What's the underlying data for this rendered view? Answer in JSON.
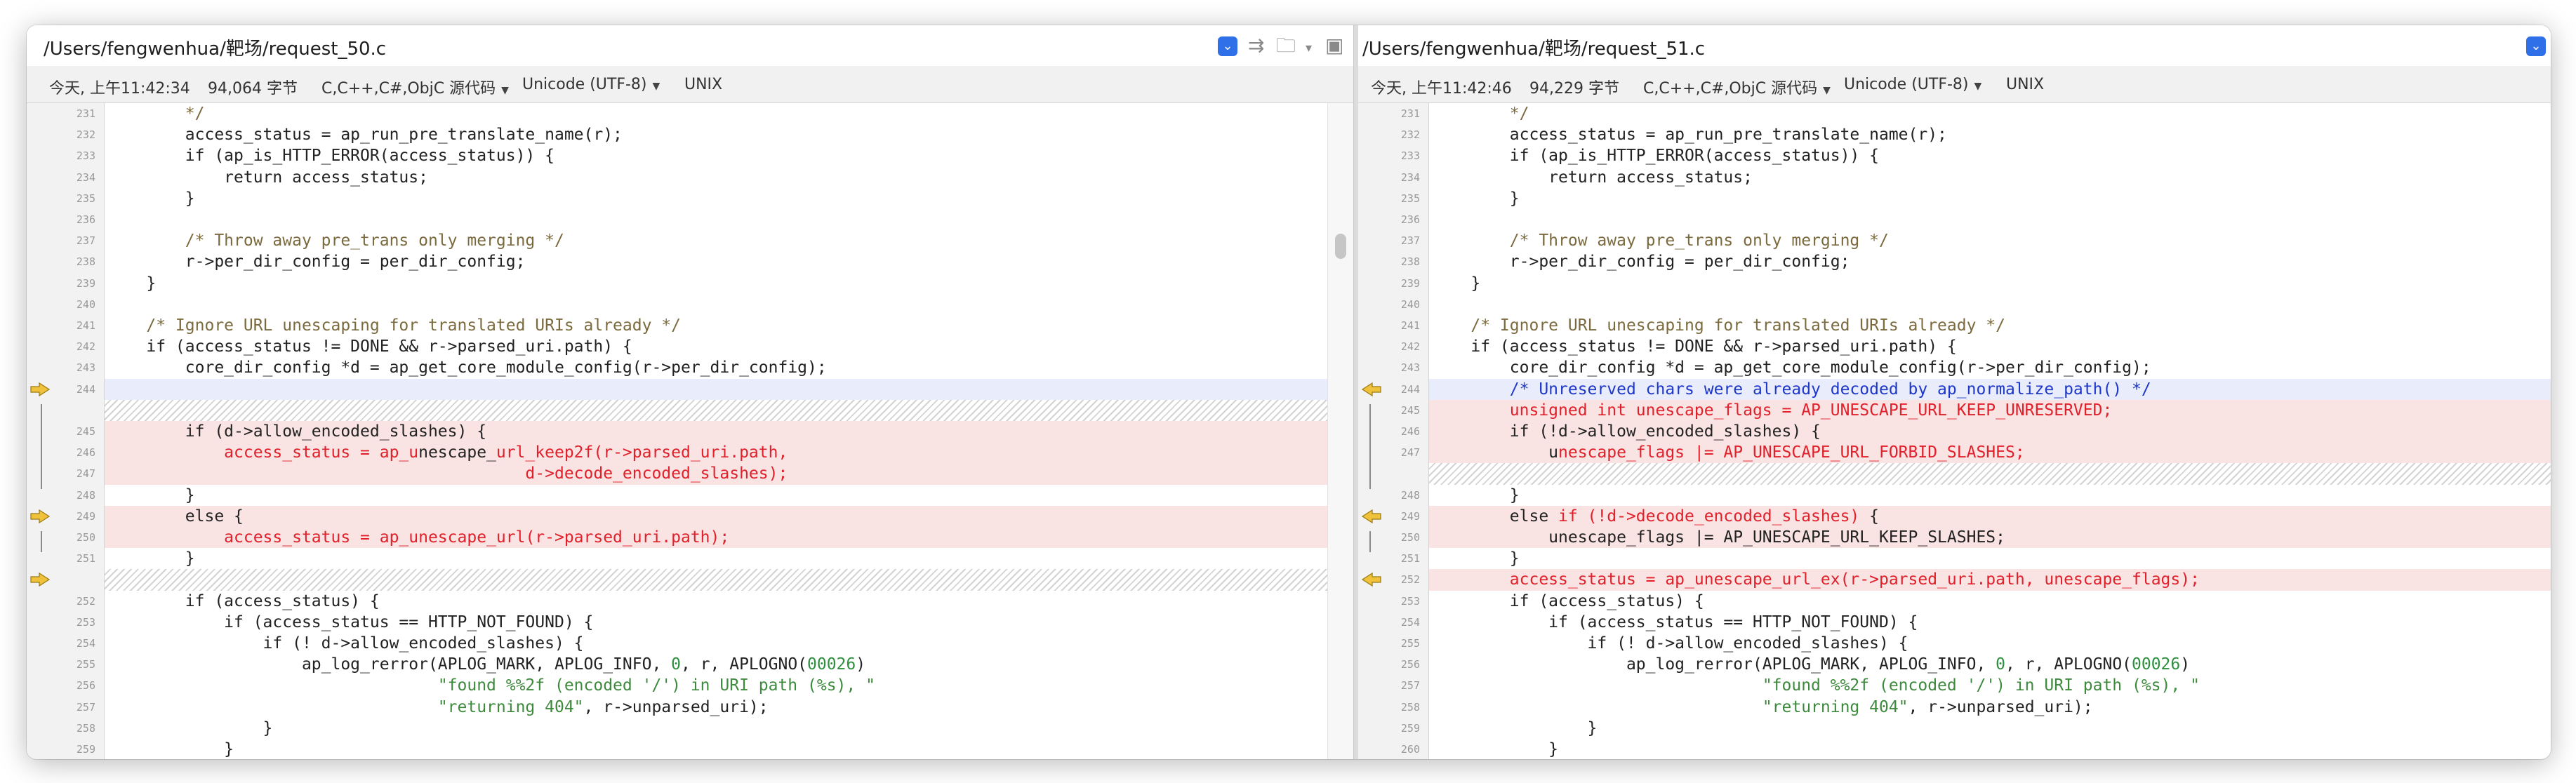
{
  "left": {
    "path": "/Users/fengwenhua/靶场/request_50.c",
    "info": {
      "time": "今天, 上午11:42:34",
      "size": "94,064 字节",
      "lang": "C,C++,C#,ObjC 源代码",
      "encoding": "Unicode (UTF-8)",
      "eol": "UNIX"
    },
    "lines": [
      {
        "n": "231",
        "type": "",
        "segs": [
          [
            "        */",
            "comment"
          ]
        ]
      },
      {
        "n": "232",
        "type": "",
        "segs": [
          [
            "        access_status = ap_run_pre_translate_name(r);",
            ""
          ]
        ]
      },
      {
        "n": "233",
        "type": "",
        "segs": [
          [
            "        if (ap_is_HTTP_ERROR(access_status)) {",
            ""
          ]
        ]
      },
      {
        "n": "234",
        "type": "",
        "segs": [
          [
            "            return access_status;",
            ""
          ]
        ]
      },
      {
        "n": "235",
        "type": "",
        "segs": [
          [
            "        }",
            ""
          ]
        ]
      },
      {
        "n": "236",
        "type": "",
        "segs": []
      },
      {
        "n": "237",
        "type": "",
        "segs": [
          [
            "        /* Throw away pre_trans only merging */",
            "comment"
          ]
        ]
      },
      {
        "n": "238",
        "type": "",
        "segs": [
          [
            "        r->per_dir_config = per_dir_config;",
            ""
          ]
        ]
      },
      {
        "n": "239",
        "type": "",
        "segs": [
          [
            "    }",
            ""
          ]
        ]
      },
      {
        "n": "240",
        "type": "",
        "segs": []
      },
      {
        "n": "241",
        "type": "",
        "segs": [
          [
            "    /* Ignore URL unescaping for translated URIs already */",
            "comment"
          ]
        ]
      },
      {
        "n": "242",
        "type": "",
        "segs": [
          [
            "    if (access_status != DONE && r->parsed_uri.path) {",
            ""
          ]
        ]
      },
      {
        "n": "243",
        "type": "",
        "segs": [
          [
            "        core_dir_config *d = ap_get_core_module_config(r->per_dir_config);",
            ""
          ]
        ]
      },
      {
        "n": "244",
        "type": "cur",
        "segs": []
      },
      {
        "n": "",
        "type": "hatch",
        "segs": []
      },
      {
        "n": "245",
        "type": "changed",
        "segs": [
          [
            "        if (d->allow_encoded_slashes) {",
            ""
          ]
        ]
      },
      {
        "n": "246",
        "type": "changed",
        "segs": [
          [
            "            access_status = ap_u",
            "red"
          ],
          [
            "nescape_",
            ""
          ],
          [
            "url_keep2f(r->parsed_uri.path,",
            "red"
          ]
        ]
      },
      {
        "n": "247",
        "type": "changed",
        "segs": [
          [
            "                                           d->decode_encoded_slashes);",
            "red"
          ]
        ]
      },
      {
        "n": "248",
        "type": "",
        "segs": [
          [
            "        }",
            ""
          ]
        ]
      },
      {
        "n": "249",
        "type": "changed",
        "segs": [
          [
            "        else {",
            ""
          ]
        ]
      },
      {
        "n": "250",
        "type": "changed",
        "segs": [
          [
            "            access_status = ap_unescape_url",
            "red"
          ],
          [
            "(r->parsed_uri.path);",
            "red"
          ]
        ]
      },
      {
        "n": "251",
        "type": "",
        "segs": [
          [
            "        }",
            ""
          ]
        ]
      },
      {
        "n": "",
        "type": "hatch",
        "segs": []
      },
      {
        "n": "252",
        "type": "",
        "segs": [
          [
            "        if (access_status) {",
            ""
          ]
        ]
      },
      {
        "n": "253",
        "type": "",
        "segs": [
          [
            "            if (access_status == HTTP_NOT_FOUND) {",
            ""
          ]
        ]
      },
      {
        "n": "254",
        "type": "",
        "segs": [
          [
            "                if (! d->allow_encoded_slashes) {",
            ""
          ]
        ]
      },
      {
        "n": "255",
        "type": "",
        "segs": [
          [
            "                    ap_log_rerror(APLOG_MARK, APLOG_INFO, ",
            ""
          ],
          [
            "0",
            "num"
          ],
          [
            ", r, APLOGNO(",
            ""
          ],
          [
            "00026",
            "num"
          ],
          [
            ")",
            ""
          ]
        ]
      },
      {
        "n": "256",
        "type": "",
        "segs": [
          [
            "                                  ",
            ""
          ],
          [
            "\"found %%2f (encoded '/') in URI path (%s), \"",
            "str"
          ]
        ]
      },
      {
        "n": "257",
        "type": "",
        "segs": [
          [
            "                                  ",
            ""
          ],
          [
            "\"returning 404\"",
            "str"
          ],
          [
            ", r->unparsed_uri);",
            ""
          ]
        ]
      },
      {
        "n": "258",
        "type": "",
        "segs": [
          [
            "                }",
            ""
          ]
        ]
      },
      {
        "n": "259",
        "type": "",
        "segs": [
          [
            "            }",
            ""
          ]
        ]
      }
    ]
  },
  "right": {
    "path": "/Users/fengwenhua/靶场/request_51.c",
    "info": {
      "time": "今天, 上午11:42:46",
      "size": "94,229 字节",
      "lang": "C,C++,C#,ObjC 源代码",
      "encoding": "Unicode (UTF-8)",
      "eol": "UNIX"
    },
    "lines": [
      {
        "n": "231",
        "type": "",
        "segs": [
          [
            "        */",
            "comment"
          ]
        ]
      },
      {
        "n": "232",
        "type": "",
        "segs": [
          [
            "        access_status = ap_run_pre_translate_name(r);",
            ""
          ]
        ]
      },
      {
        "n": "233",
        "type": "",
        "segs": [
          [
            "        if (ap_is_HTTP_ERROR(access_status)) {",
            ""
          ]
        ]
      },
      {
        "n": "234",
        "type": "",
        "segs": [
          [
            "            return access_status;",
            ""
          ]
        ]
      },
      {
        "n": "235",
        "type": "",
        "segs": [
          [
            "        }",
            ""
          ]
        ]
      },
      {
        "n": "236",
        "type": "",
        "segs": []
      },
      {
        "n": "237",
        "type": "",
        "segs": [
          [
            "        /* Throw away pre_trans only merging */",
            "comment"
          ]
        ]
      },
      {
        "n": "238",
        "type": "",
        "segs": [
          [
            "        r->per_dir_config = per_dir_config;",
            ""
          ]
        ]
      },
      {
        "n": "239",
        "type": "",
        "segs": [
          [
            "    }",
            ""
          ]
        ]
      },
      {
        "n": "240",
        "type": "",
        "segs": []
      },
      {
        "n": "241",
        "type": "",
        "segs": [
          [
            "    /* Ignore URL unescaping for translated URIs already */",
            "comment"
          ]
        ]
      },
      {
        "n": "242",
        "type": "",
        "segs": [
          [
            "    if (access_status != DONE && r->parsed_uri.path) {",
            ""
          ]
        ]
      },
      {
        "n": "243",
        "type": "",
        "segs": [
          [
            "        core_dir_config *d = ap_get_core_module_config(r->per_dir_config);",
            ""
          ]
        ]
      },
      {
        "n": "244",
        "type": "cur",
        "segs": [
          [
            "        /* Unreserved chars were already decoded by ap_normalize_path() */",
            "ccomment"
          ]
        ]
      },
      {
        "n": "245",
        "type": "changed",
        "segs": [
          [
            "        unsigned int unescape_flags = AP_UNESCAPE_URL_KEEP_UNRESERVED;",
            "red"
          ]
        ]
      },
      {
        "n": "246",
        "type": "changed",
        "segs": [
          [
            "        if (!d->allow_encoded_slashes) {",
            ""
          ]
        ]
      },
      {
        "n": "247",
        "type": "changed",
        "segs": [
          [
            "            u",
            ""
          ],
          [
            "nescape_",
            "red"
          ],
          [
            "flags |= AP_UNESCAPE_URL_FORBID_SLASHES;",
            "red"
          ]
        ]
      },
      {
        "n": "",
        "type": "hatch",
        "segs": []
      },
      {
        "n": "248",
        "type": "",
        "segs": [
          [
            "        }",
            ""
          ]
        ]
      },
      {
        "n": "249",
        "type": "changed",
        "segs": [
          [
            "        else ",
            ""
          ],
          [
            "if (!d->decode_encoded_slashes)",
            "red"
          ],
          [
            " {",
            ""
          ]
        ]
      },
      {
        "n": "250",
        "type": "changed",
        "segs": [
          [
            "            unescape_",
            ""
          ],
          [
            "flags |= AP_UNESCAPE_URL_KEEP_SLASHES;",
            ""
          ]
        ]
      },
      {
        "n": "251",
        "type": "",
        "segs": [
          [
            "        }",
            ""
          ]
        ]
      },
      {
        "n": "252",
        "type": "changed",
        "segs": [
          [
            "        access_status = ap_unescape_url_ex(r->parsed_uri.path, unescape_flags);",
            "red"
          ]
        ]
      },
      {
        "n": "253",
        "type": "",
        "segs": [
          [
            "        if (access_status) {",
            ""
          ]
        ]
      },
      {
        "n": "254",
        "type": "",
        "segs": [
          [
            "            if (access_status == HTTP_NOT_FOUND) {",
            ""
          ]
        ]
      },
      {
        "n": "255",
        "type": "",
        "segs": [
          [
            "                if (! d->allow_encoded_slashes) {",
            ""
          ]
        ]
      },
      {
        "n": "256",
        "type": "",
        "segs": [
          [
            "                    ap_log_rerror(APLOG_MARK, APLOG_INFO, ",
            ""
          ],
          [
            "0",
            "num"
          ],
          [
            ", r, APLOGNO(",
            ""
          ],
          [
            "00026",
            "num"
          ],
          [
            ")",
            ""
          ]
        ]
      },
      {
        "n": "257",
        "type": "",
        "segs": [
          [
            "                                  ",
            ""
          ],
          [
            "\"found %%2f (encoded '/') in URI path (%s), \"",
            "str"
          ]
        ]
      },
      {
        "n": "258",
        "type": "",
        "segs": [
          [
            "                                  ",
            ""
          ],
          [
            "\"returning 404\"",
            "str"
          ],
          [
            ", r->unparsed_uri);",
            ""
          ]
        ]
      },
      {
        "n": "259",
        "type": "",
        "segs": [
          [
            "                }",
            ""
          ]
        ]
      },
      {
        "n": "260",
        "type": "",
        "segs": [
          [
            "            }",
            ""
          ]
        ]
      }
    ]
  },
  "icons": {
    "dropdown": "chevron-down-icon",
    "merge": "merge-arrows-icon",
    "folder": "folder-icon",
    "save": "save-icon",
    "diff_marker": "diff-arrow-icon"
  },
  "colors": {
    "changed_bg": "#fae3e3",
    "removed_text": "#e0202a",
    "accent": "#2f6fe8",
    "comment": "#7b6a3e",
    "arrow": "#f0c23c"
  }
}
